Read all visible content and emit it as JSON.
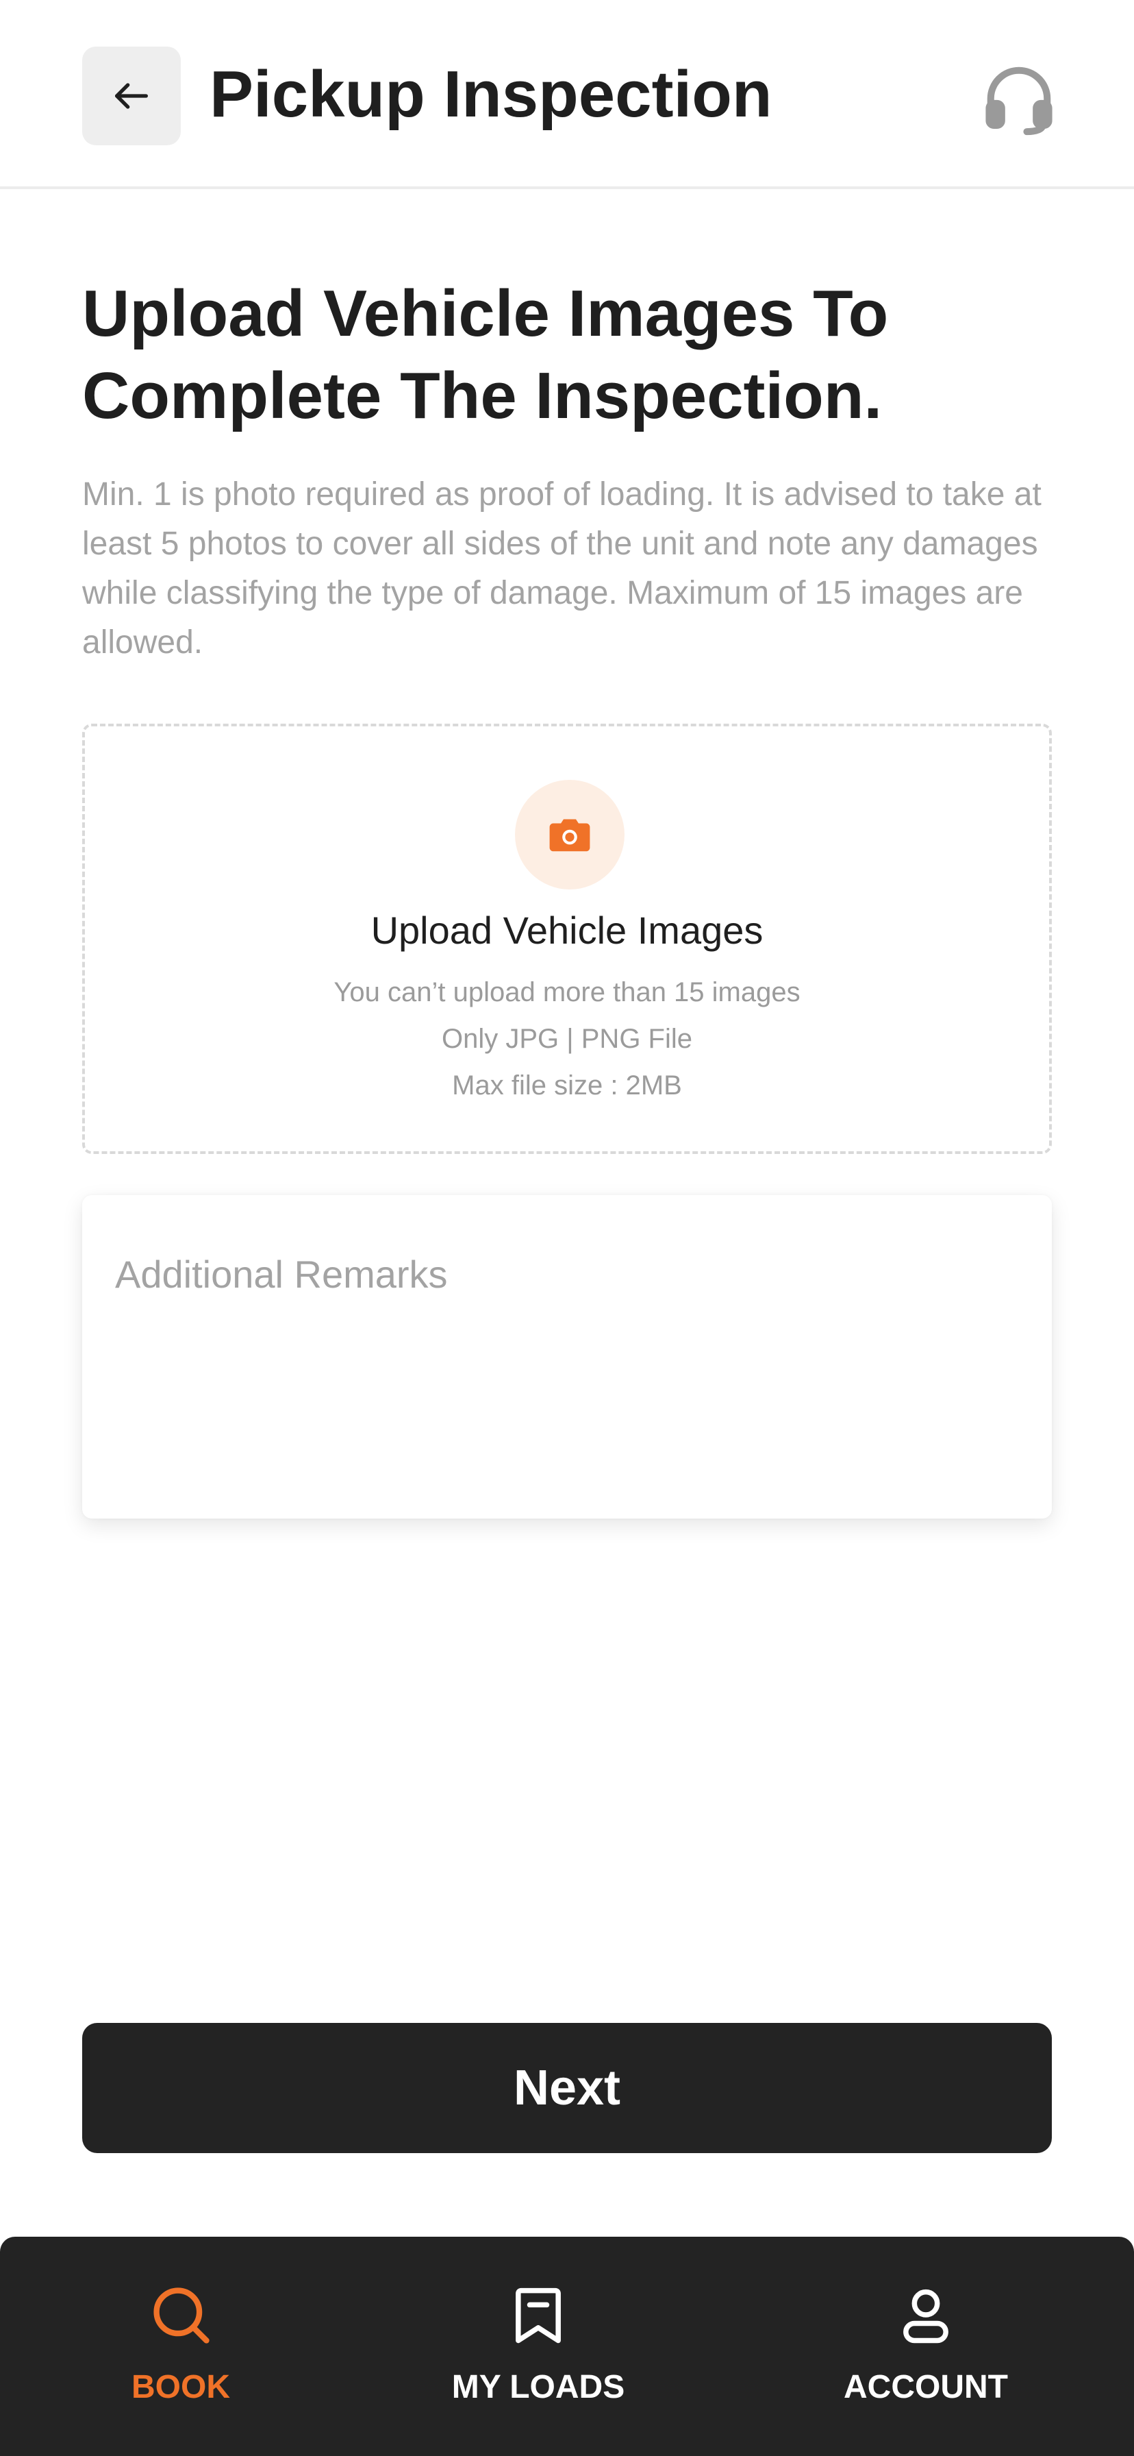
{
  "header": {
    "title": "Pickup Inspection",
    "back_icon": "arrow-left-icon",
    "support_icon": "headset-icon"
  },
  "intro": {
    "heading": "Upload Vehicle Images To Complete The Inspection.",
    "description": "Min. 1 is photo required as proof of loading. It is advised to take at least 5 photos to cover all sides of the unit and note any damages while classifying the type of damage. Maximum of 15 images are allowed."
  },
  "upload": {
    "icon": "camera-icon",
    "title": "Upload Vehicle Images",
    "notes": [
      "You can’t upload more than 15 images",
      "Only JPG | PNG File",
      "Max file size : 2MB"
    ]
  },
  "remarks": {
    "placeholder": "Additional Remarks",
    "value": ""
  },
  "actions": {
    "next_label": "Next"
  },
  "bottom_nav": {
    "items": [
      {
        "label": "BOOK",
        "icon": "search-icon",
        "active": true
      },
      {
        "label": "MY LOADS",
        "icon": "bookmark-icon",
        "active": false
      },
      {
        "label": "ACCOUNT",
        "icon": "user-icon",
        "active": false
      }
    ]
  },
  "colors": {
    "accent": "#f07228",
    "dark": "#232323",
    "muted_text": "#a3a3a3",
    "accent_tint": "#fdeee3"
  }
}
